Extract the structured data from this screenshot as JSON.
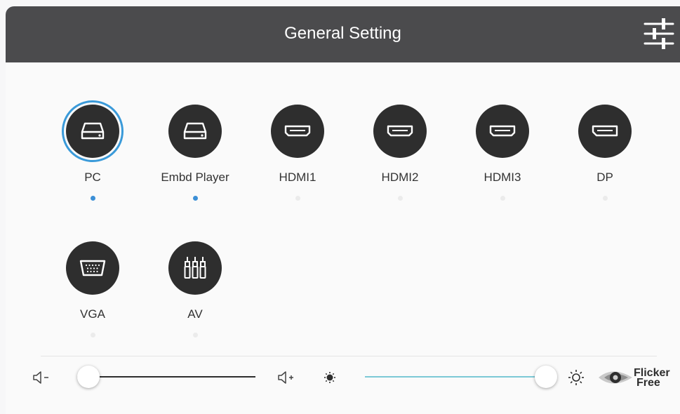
{
  "header": {
    "title": "General Setting"
  },
  "sources": [
    {
      "label": "PC",
      "icon": "drive-icon",
      "selected": true,
      "active": true
    },
    {
      "label": "Embd Player",
      "icon": "drive-icon",
      "selected": false,
      "active": true
    },
    {
      "label": "HDMI1",
      "icon": "hdmi-port-icon",
      "selected": false,
      "active": false
    },
    {
      "label": "HDMI2",
      "icon": "hdmi-port-icon",
      "selected": false,
      "active": false
    },
    {
      "label": "HDMI3",
      "icon": "hdmi-port-icon",
      "selected": false,
      "active": false
    },
    {
      "label": "DP",
      "icon": "displayport-icon",
      "selected": false,
      "active": false
    },
    {
      "label": "VGA",
      "icon": "vga-port-icon",
      "selected": false,
      "active": false
    },
    {
      "label": "AV",
      "icon": "av-jacks-icon",
      "selected": false,
      "active": false
    }
  ],
  "volume": {
    "level": 0,
    "min_icon": "volume-down-icon",
    "max_icon": "volume-up-icon"
  },
  "brightness": {
    "level": 100,
    "min_icon": "brightness-low-icon",
    "max_icon": "brightness-high-icon"
  },
  "flicker_free": {
    "line1": "Flicker",
    "line2": "Free"
  },
  "colors": {
    "header_bg": "#4b4b4d",
    "accent": "#3a9ad9",
    "brightness_track": "#7cc9d6",
    "icon_circle": "#2e2e2e"
  }
}
